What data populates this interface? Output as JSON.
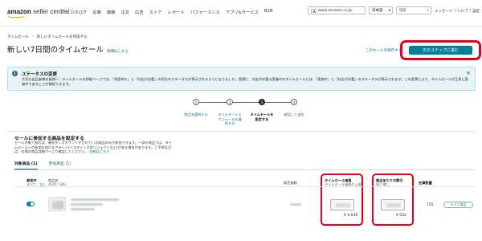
{
  "header": {
    "logo_bold": "amazon",
    "logo_sub": "seller central",
    "logo_mark": "P",
    "nav": [
      "カタログ",
      "在庫",
      "価格",
      "注文",
      "広告",
      "ストア",
      "レポート",
      "パフォーマンス",
      "アプリ&サービス",
      "B2B"
    ],
    "marketplace": "www.amazon.co.jp",
    "language": "日本語",
    "search_placeholder": "検索",
    "links": [
      "メッセージ",
      "|",
      "ヘルプ",
      "|",
      "設定"
    ]
  },
  "breadcrumb": [
    "タイムセール",
    "新しいタイムセールを作成する"
  ],
  "page": {
    "title": "新しい7日間のタイムセール",
    "learn_link": "詳細はこちら",
    "back_link": "このセールを保存する",
    "next_button": "次のステップに進む",
    "accent": "#008296",
    "highlight": "#e4001b"
  },
  "banner": {
    "title": "ステータスの変更",
    "text": "大切な出品者様の皆様へ：タイムセールの詳細ページでは、「承認待ち」と「対応が必要」の両方のステータスが表示されるようになりました。実際に、対応が必要な実施中のタイムセールには、「実施中」と「対応が必要」のステータスが表示されます。この変更により、タイムセールが正常に実施中であることが確認できます。",
    "close": "×"
  },
  "steps": [
    {
      "num": "1",
      "label": "商品を選択する",
      "state": "done"
    },
    {
      "num": "2",
      "label": "タイムセールス\nケジュールを選\n択する",
      "state": "done"
    },
    {
      "num": "3",
      "label": "タイムセールを\n設定する",
      "state": "active"
    },
    {
      "num": "4",
      "label": "確認して送信",
      "state": "future"
    }
  ],
  "section": {
    "title": "セールに参加する商品を設定する",
    "desc": "セール対象であれば、最低ディスカウントがされている商品のみが参加できます。一部の商品では、タイムセールへの参加を妨げるアラート(リスティングのリジェクトなど)がある場合があります。ご不明な点は、在庫の商品詳細ページで確認してください。",
    "desc_link": "詳細はこちら"
  },
  "tabs": [
    {
      "label": "対象商品",
      "count": "(1)",
      "active": true
    },
    {
      "label": "参加商品",
      "count": "(1)",
      "active": false
    }
  ],
  "table": {
    "headers": {
      "participate": "参加中",
      "select_all": "すべて",
      "select_none": "なし",
      "product": "商品名",
      "asin": "ASIN / SKU",
      "current_price": "販売価格",
      "deal_price": "タイムセール価格",
      "deal_price_sub": "タイムセール価格の上限",
      "per_item": "商品あたりの割引",
      "per_item_sub": "割り増し",
      "quantity": "在庫数量"
    },
    "row": {
      "enabled": true,
      "deal_price_max": "¥ 4,030",
      "discount_max": "¥ 532",
      "quantity": "725",
      "badge": "メイン商品"
    }
  }
}
